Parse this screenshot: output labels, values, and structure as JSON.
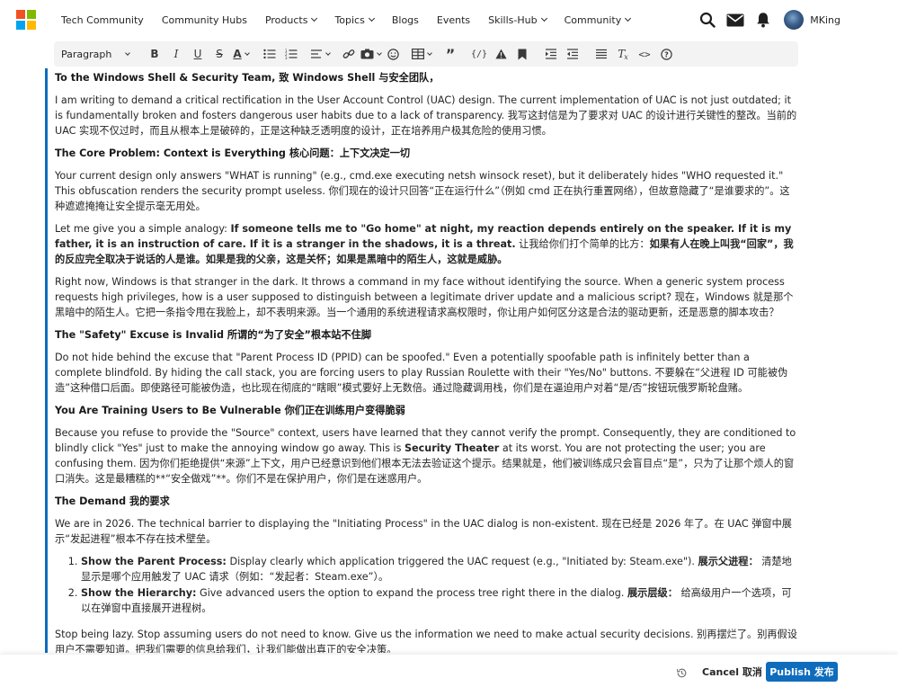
{
  "nav": {
    "links": [
      {
        "label": "Tech Community",
        "has_dropdown": false
      },
      {
        "label": "Community Hubs",
        "has_dropdown": false
      },
      {
        "label": "Products",
        "has_dropdown": true
      },
      {
        "label": "Topics",
        "has_dropdown": true
      },
      {
        "label": "Blogs",
        "has_dropdown": false
      },
      {
        "label": "Events",
        "has_dropdown": false
      },
      {
        "label": "Skills-Hub",
        "has_dropdown": true
      },
      {
        "label": "Community",
        "has_dropdown": true
      }
    ],
    "icons": [
      "search-icon",
      "mail-icon",
      "bell-icon"
    ],
    "username": "MKing"
  },
  "toolbar": {
    "paragraph_style": "Paragraph",
    "buttons": [
      "bold-icon",
      "italic-icon",
      "underline-icon",
      "strikethrough-icon",
      "text-color-icon",
      "bulleted-list-icon",
      "numbered-list-icon",
      "align-icon",
      "link-icon",
      "image-icon",
      "emoji-icon",
      "table-icon",
      "quote-icon",
      "code-icon",
      "spoiler-icon",
      "bookmark-icon",
      "indent-icon",
      "outdent-icon",
      "list-icon",
      "clear-format-icon",
      "source-code-icon",
      "help-icon"
    ]
  },
  "colors": {
    "accent": "#0f6cbd",
    "ms_red": "#f25022",
    "ms_green": "#7fba00",
    "ms_blue": "#00a4ef",
    "ms_yellow": "#ffb900"
  },
  "content": {
    "greeting": "To the Windows Shell & Security Team, 致 Windows Shell 与安全团队，",
    "intro": "I am writing to demand a critical rectification in the User Account Control (UAC) design. The current implementation of UAC is not just outdated; it is fundamentally broken and fosters dangerous user habits due to a lack of transparency. 我写这封信是为了要求对 UAC 的设计进行关键性的整改。当前的 UAC 实现不仅过时，而且从根本上是破碎的，正是这种缺乏透明度的设计，正在培养用户极其危险的使用习惯。",
    "h1": "The Core Problem: Context is Everything 核心问题：上下文决定一切",
    "p1": "Your current design only answers \"WHAT is running\" (e.g., cmd.exe executing netsh winsock reset), but it deliberately hides \"WHO requested it.\" This obfuscation renders the security prompt useless. 你们现在的设计只回答“正在运行什么”（例如 cmd 正在执行重置网络），但故意隐藏了“是谁要求的”。这种遮遮掩掩让安全提示毫无用处。",
    "p2_a": "Let me give you a simple analogy: ",
    "p2_b": "If someone tells me to \"Go home\" at night, my reaction depends entirely on the speaker. If it is my father, it is an instruction of care. If it is a stranger in the shadows, it is a threat.",
    "p2_c": " 让我给你们打个简单的比方：",
    "p2_d": "如果有人在晚上叫我“回家”，我的反应完全取决于说话的人是谁。如果是我的父亲，这是关怀；如果是黑暗中的陌生人，这就是威胁。",
    "p3": "Right now, Windows is that stranger in the dark. It throws a command in my face without identifying the source. When a generic system process requests high privileges, how is a user supposed to distinguish between a legitimate driver update and a malicious script? 现在，Windows 就是那个黑暗中的陌生人。它把一条指令甩在我脸上，却不表明来源。当一个通用的系统进程请求高权限时，你让用户如何区分这是合法的驱动更新，还是恶意的脚本攻击？",
    "h2": "The \"Safety\" Excuse is Invalid 所谓的“为了安全”根本站不住脚",
    "p4": "Do not hide behind the excuse that \"Parent Process ID (PPID) can be spoofed.\" Even a potentially spoofable path is infinitely better than a complete blindfold. By hiding the call stack, you are forcing users to play Russian Roulette with their \"Yes/No\" buttons. 不要躲在“父进程 ID 可能被伪造”这种借口后面。即使路径可能被伪造，也比现在彻底的“瞎眼”模式要好上无数倍。通过隐藏调用栈，你们是在逼迫用户对着“是/否”按钮玩俄罗斯轮盘赌。",
    "h3": "You Are Training Users to Be Vulnerable 你们正在训练用户变得脆弱",
    "p5_a": "Because you refuse to provide the \"Source\" context, users have learned that they cannot verify the prompt. Consequently, they are conditioned to blindly click \"Yes\" just to make the annoying window go away. This is ",
    "p5_b": "Security Theater",
    "p5_c": " at its worst. You are not protecting the user; you are confusing them. 因为你们拒绝提供“来源”上下文，用户已经意识到他们根本无法去验证这个提示。结果就是，他们被训练成只会盲目点“是”，只为了让那个烦人的窗口消失。这是最糟糕的**“安全做戏”**。你们不是在保护用户，你们是在迷惑用户。",
    "h4": "The Demand 我的要求",
    "p6": "We are in 2026. The technical barrier to displaying the \"Initiating Process\" in the UAC dialog is non-existent. 现在已经是 2026 年了。在 UAC 弹窗中展示“发起进程”根本不存在技术壁垒。",
    "li1_a": "Show the Parent Process:",
    "li1_b": " Display clearly which application triggered the UAC request (e.g., \"Initiated by: Steam.exe\"). ",
    "li1_c": "展示父进程：",
    "li1_d": " 清楚地显示是哪个应用触发了 UAC 请求（例如：“发起者：Steam.exe”）。",
    "li2_a": "Show the Hierarchy:",
    "li2_b": " Give advanced users the option to expand the process tree right there in the dialog. ",
    "li2_c": "展示层级：",
    "li2_d": " 给高级用户一个选项，可以在弹窗中直接展开进程树。",
    "p7": "Stop being lazy. Stop assuming users do not need to know. Give us the information we need to make actual security decisions. 别再摆烂了。别再假设用户不需要知道。把我们需要的信息给我们，让我们能做出真正的安全决策。"
  },
  "actions": {
    "cancel_label": "Cancel 取消",
    "publish_label": "Publish 发布"
  }
}
